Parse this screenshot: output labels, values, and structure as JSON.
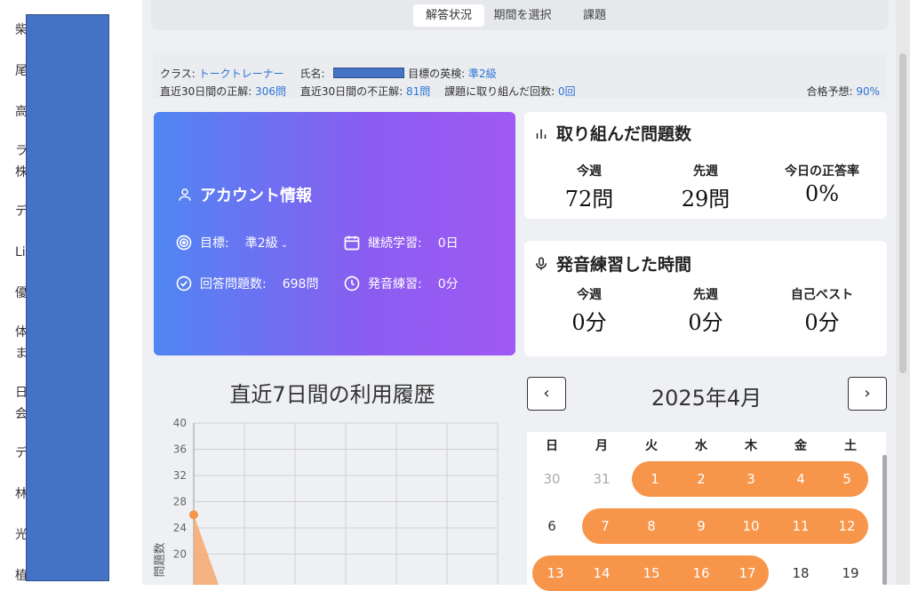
{
  "left_list": [
    "柴",
    "尾",
    "高",
    "ラ",
    "株",
    "デ",
    "Li",
    "優",
    "体",
    "ま",
    "日",
    "会",
    "デ",
    "林",
    "光",
    "植"
  ],
  "tabs": [
    "解答状況",
    "期間を選択",
    "課題"
  ],
  "info": {
    "class_label": "クラス: ",
    "class_value": "トークトレーナー",
    "name_label": "氏名: ",
    "target_label": "目標の英検: ",
    "target_value": "準2級",
    "correct_label": "直近30日間の正解: ",
    "correct_value": "306問",
    "incorrect_label": "直近30日間の不正解: ",
    "incorrect_value": "81問",
    "tasks_label": "課題に取り組んだ回数: ",
    "tasks_value": "0回",
    "pass_label": "合格予想: ",
    "pass_value": "90%"
  },
  "account": {
    "title": "アカウント情報",
    "goal_label": "目標:",
    "goal_value": "準2級",
    "streak_label": "継続学習:",
    "streak_value": "0日",
    "answered_label": "回答問題数:",
    "answered_value": "698問",
    "pron_label": "発音練習:",
    "pron_value": "0分"
  },
  "problems_card": {
    "title": "取り組んだ問題数",
    "stats": [
      {
        "label": "今週",
        "value": "72問"
      },
      {
        "label": "先週",
        "value": "29問"
      },
      {
        "label": "今日の正答率",
        "value": "0%"
      }
    ]
  },
  "pron_card": {
    "title": "発音練習した時間",
    "stats": [
      {
        "label": "今週",
        "value": "0分"
      },
      {
        "label": "先週",
        "value": "0分"
      },
      {
        "label": "自己ベスト",
        "value": "0分"
      }
    ]
  },
  "history": {
    "title": "直近7日間の利用履歴",
    "ylabel": "問題数"
  },
  "chart_data": {
    "type": "area",
    "title": "直近7日間の利用履歴",
    "ylabel": "問題数",
    "ylim": [
      0,
      40
    ],
    "yticks": [
      20,
      24,
      28,
      32,
      36,
      40
    ],
    "series": [
      {
        "values": [
          26
        ]
      }
    ],
    "grid": true
  },
  "calendar": {
    "prev_label": "‹",
    "next_label": "›",
    "title": "2025年4月",
    "weekdays": [
      "日",
      "月",
      "火",
      "水",
      "木",
      "金",
      "土"
    ],
    "weeks": [
      [
        "30",
        "31",
        "1",
        "2",
        "3",
        "4",
        "5"
      ],
      [
        "6",
        "7",
        "8",
        "9",
        "10",
        "11",
        "12"
      ],
      [
        "13",
        "14",
        "15",
        "16",
        "17",
        "18",
        "19"
      ]
    ]
  },
  "colors": {
    "accent": "#2b74d6",
    "highlight": "#f7954a",
    "card_from": "#4f86f2",
    "card_to": "#a05af3"
  }
}
